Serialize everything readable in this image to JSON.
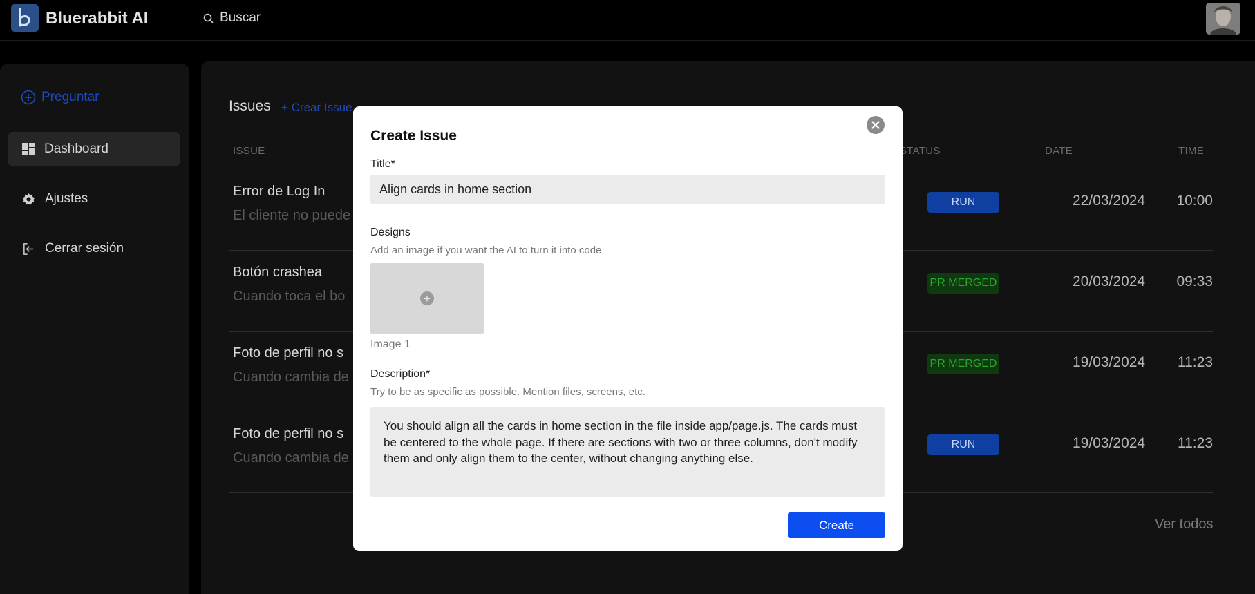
{
  "app": {
    "name": "Bluerabbit AI"
  },
  "search": {
    "placeholder": "Buscar"
  },
  "sidebar": {
    "ask_label": "Preguntar",
    "items": [
      {
        "label": "Dashboard",
        "icon": "dashboard-icon",
        "active": true
      },
      {
        "label": "Ajustes",
        "icon": "gear-icon",
        "active": false
      },
      {
        "label": "Cerrar sesión",
        "icon": "logout-icon",
        "active": false
      }
    ]
  },
  "issues": {
    "title": "Issues",
    "create_link": "+ Crear Issue",
    "columns": {
      "issue": "ISSUE",
      "status": "STATUS",
      "date": "DATE",
      "time": "TIME"
    },
    "rows": [
      {
        "title": "Error de Log In",
        "subtitle": "El cliente no puede",
        "status": "RUN",
        "date": "22/03/2024",
        "time": "10:00"
      },
      {
        "title": "Botón crashea",
        "subtitle": "Cuando toca el bo",
        "status": "PR MERGED",
        "date": "20/03/2024",
        "time": "09:33"
      },
      {
        "title": "Foto de perfil no s",
        "subtitle": "Cuando cambia de",
        "status": "PR MERGED",
        "date": "19/03/2024",
        "time": "11:23"
      },
      {
        "title": "Foto de perfil no s",
        "subtitle": "Cuando cambia de",
        "status": "RUN",
        "date": "19/03/2024",
        "time": "11:23"
      }
    ],
    "see_all": "Ver todos"
  },
  "modal": {
    "title": "Create Issue",
    "title_label": "Title*",
    "title_value": "Align cards in home section",
    "designs_label": "Designs",
    "designs_hint": "Add an image if you want the AI to turn it into code",
    "image_label": "Image 1",
    "description_label": "Description*",
    "description_hint": "Try to be as specific as possible. Mention files, screens, etc.",
    "description_value": "You should align all the cards in home section in the file inside app/page.js. The cards must be centered to the whole page. If there are sections with two or three columns, don't modify them and only align them to the center, without changing anything else.",
    "create_label": "Create"
  },
  "colors": {
    "accent": "#0c4ef0",
    "run_badge": "#0f3fa0",
    "merged_badge": "#0f3a10",
    "background": "#000000",
    "panel": "#121212"
  }
}
